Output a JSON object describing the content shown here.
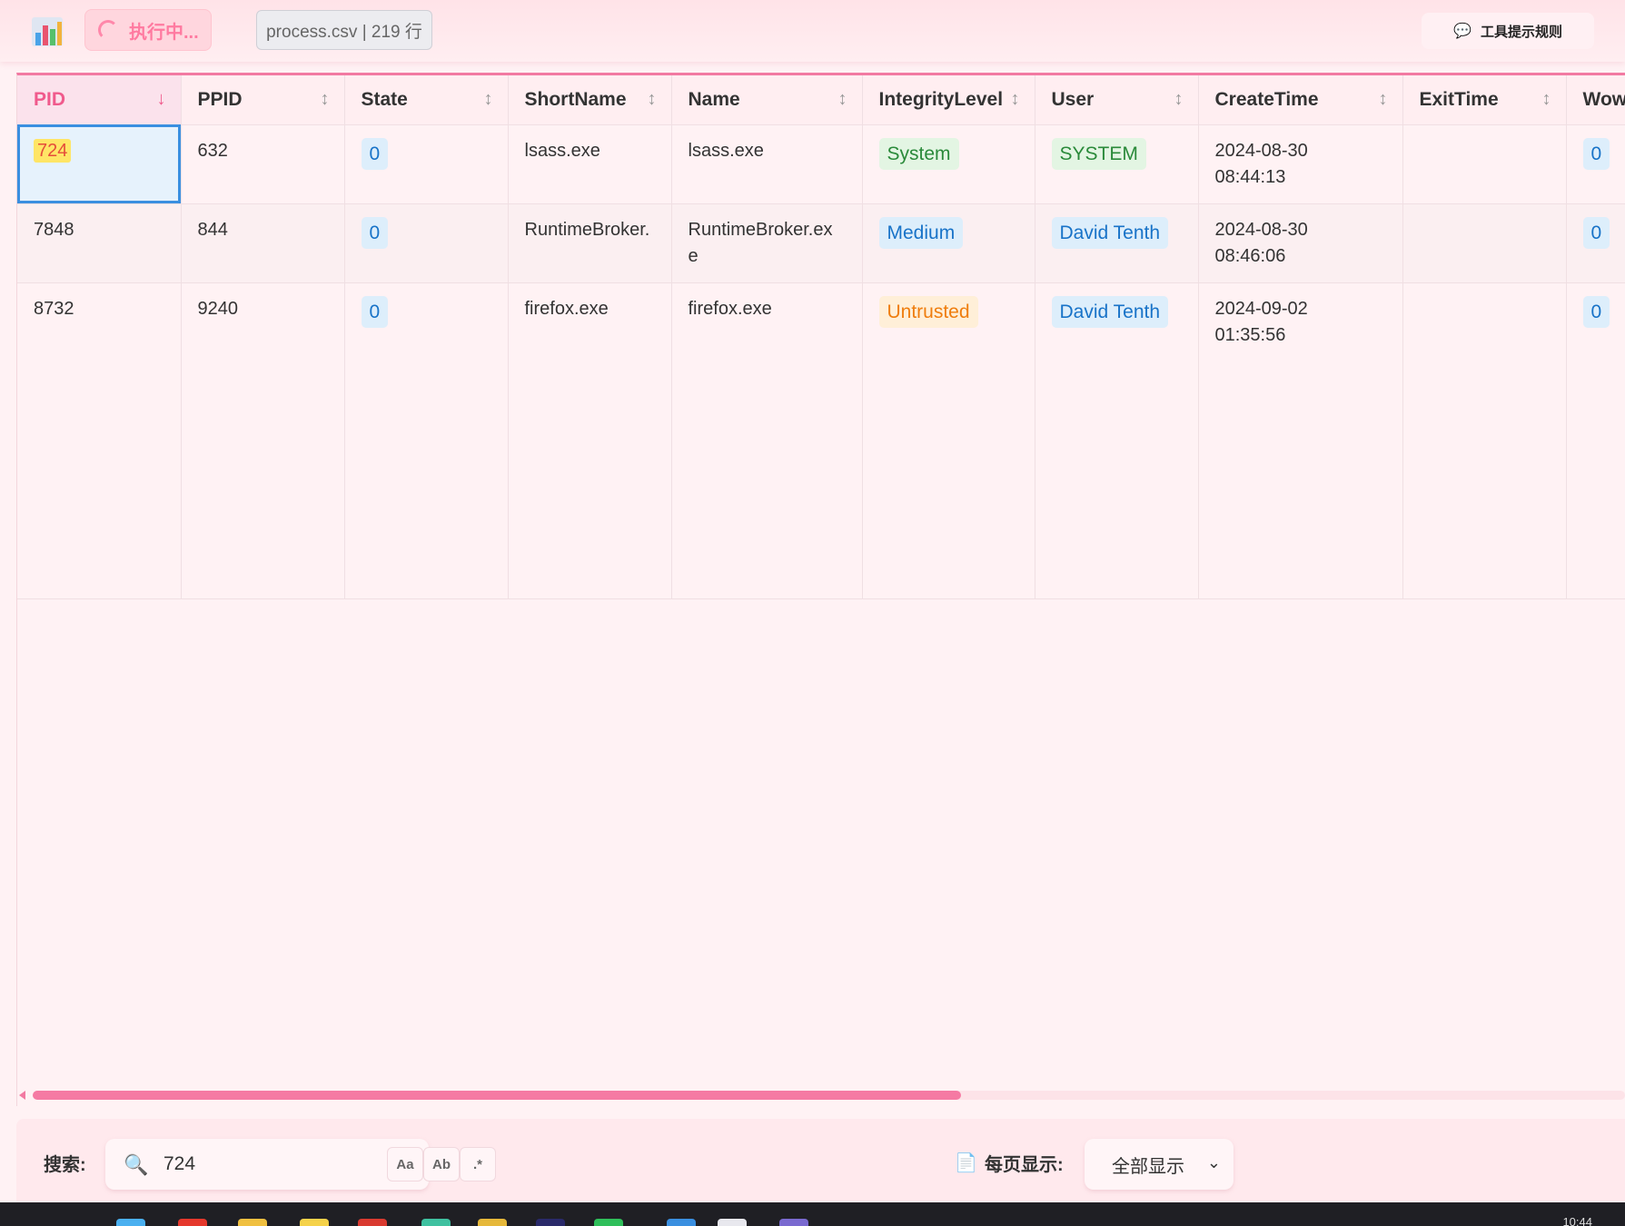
{
  "toolbar": {
    "status_label": "执行中...",
    "file_info": "process.csv | 219 行",
    "tooltip_rules_label": "工具提示规则"
  },
  "table": {
    "columns": [
      {
        "label": "PID",
        "sort": "desc"
      },
      {
        "label": "PPID",
        "sort": "none"
      },
      {
        "label": "State",
        "sort": "none"
      },
      {
        "label": "ShortName",
        "sort": "none"
      },
      {
        "label": "Name",
        "sort": "none"
      },
      {
        "label": "IntegrityLevel",
        "sort": "none"
      },
      {
        "label": "User",
        "sort": "none"
      },
      {
        "label": "CreateTime",
        "sort": "none"
      },
      {
        "label": "ExitTime",
        "sort": "none"
      },
      {
        "label": "Wow",
        "sort": "none"
      }
    ],
    "rows": [
      {
        "pid": "724",
        "ppid": "632",
        "state": "0",
        "shortname": "lsass.exe",
        "name": "lsass.exe",
        "integrity": "System",
        "user": "SYSTEM",
        "create_date": "2024-08-30",
        "create_time": "08:44:13",
        "exit": "",
        "wow": "0"
      },
      {
        "pid": "7848",
        "ppid": "844",
        "state": "0",
        "shortname": "RuntimeBroker.",
        "name": "RuntimeBroker.ex",
        "name_wrap": "e",
        "integrity": "Medium",
        "user": "David Tenth",
        "create_date": "2024-08-30",
        "create_time": "08:46:06",
        "exit": "",
        "wow": "0"
      },
      {
        "pid": "8732",
        "ppid": "9240",
        "state": "0",
        "shortname": "firefox.exe",
        "name": "firefox.exe",
        "integrity": "Untrusted",
        "user": "David Tenth",
        "create_date": "2024-09-02",
        "create_time": "01:35:56",
        "exit": "",
        "wow": "0"
      }
    ]
  },
  "search": {
    "label": "搜索:",
    "value": "724",
    "options": [
      "Aa",
      "Ab",
      ".*"
    ]
  },
  "pagination": {
    "label": "每页显示:",
    "selected": "全部显示"
  },
  "taskbar": {
    "clock": "10:44"
  },
  "colors": {
    "accent": "#f05a8c",
    "selection": "#3a8fe0",
    "pill_blue": "#1873c8",
    "pill_green": "#2a8a3a",
    "pill_orange": "#ef7d0d"
  }
}
